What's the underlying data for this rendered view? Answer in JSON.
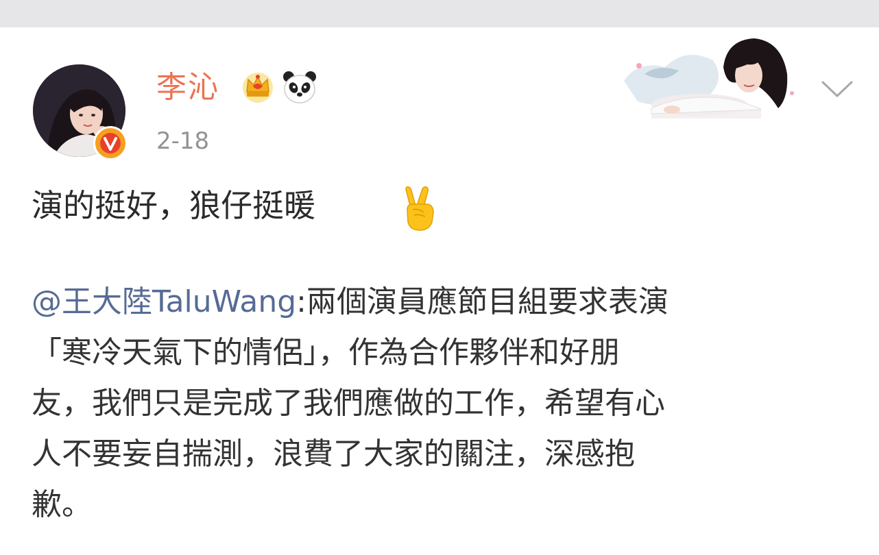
{
  "post": {
    "author": {
      "name": "李沁",
      "avatar_icon": "user-avatar",
      "badges": [
        "crown-icon",
        "panda-icon"
      ],
      "verified": true
    },
    "date": "2-18",
    "text": "演的挺好，狼仔挺暖",
    "emoji": "victory-hand-icon",
    "quoted": {
      "mention": "@王大陸TaluWang",
      "lines": [
        ":兩個演員應節目組要求表演",
        "「寒冷天氣下的情侶」，作為合作夥伴和好朋",
        "友，我們只是完成了我們應做的工作，希望有心",
        "人不要妄自揣測，浪費了大家的關注，深感抱",
        "歉。"
      ]
    }
  },
  "colors": {
    "username": "#eb7350",
    "link": "#566b95",
    "date": "#939393",
    "verified_badge": "#f5a020"
  }
}
